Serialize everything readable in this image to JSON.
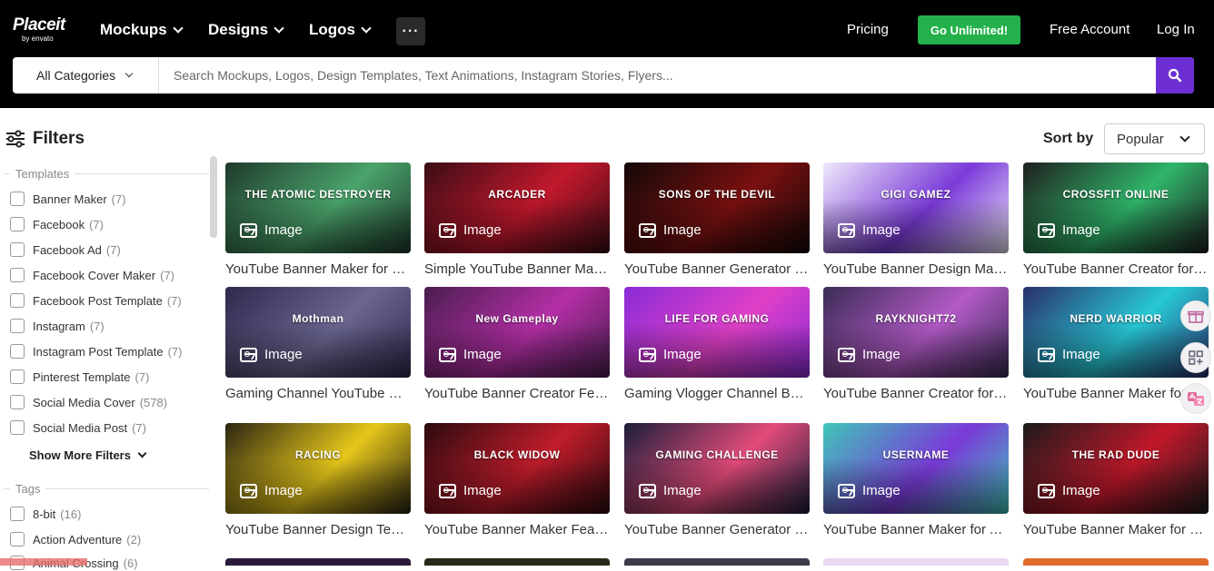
{
  "header": {
    "logo_word": "Placeit",
    "logo_by": "by envato",
    "nav": [
      "Mockups",
      "Designs",
      "Logos"
    ],
    "more_label": "···",
    "pricing": "Pricing",
    "go_unlimited": "Go Unlimited!",
    "free_account": "Free Account",
    "login": "Log In",
    "accent_color": "#24b14b",
    "search_button_color": "#6d2fd4"
  },
  "search": {
    "category": "All Categories",
    "placeholder": "Search Mockups, Logos, Design Templates, Text Animations, Instagram Stories, Flyers..."
  },
  "filters": {
    "title": "Filters",
    "templates_group": "Templates",
    "templates": [
      {
        "label": "Banner Maker",
        "count": "(7)"
      },
      {
        "label": "Facebook",
        "count": "(7)"
      },
      {
        "label": "Facebook Ad",
        "count": "(7)"
      },
      {
        "label": "Facebook Cover Maker",
        "count": "(7)"
      },
      {
        "label": "Facebook Post Template",
        "count": "(7)"
      },
      {
        "label": "Instagram",
        "count": "(7)"
      },
      {
        "label": "Instagram Post Template",
        "count": "(7)"
      },
      {
        "label": "Pinterest Template",
        "count": "(7)"
      },
      {
        "label": "Social Media Cover",
        "count": "(578)"
      },
      {
        "label": "Social Media Post",
        "count": "(7)"
      }
    ],
    "show_more": "Show More Filters",
    "tags_group": "Tags",
    "tags": [
      {
        "label": "8-bit",
        "count": "(16)"
      },
      {
        "label": "Action Adventure",
        "count": "(2)"
      },
      {
        "label": "Animal Crossing",
        "count": "(6)"
      }
    ]
  },
  "sort": {
    "label": "Sort by",
    "value": "Popular"
  },
  "badge_label": "Image",
  "cards": [
    {
      "title": "YouTube Banner Maker for a Gaming Channel",
      "headline": "THE ATOMIC DESTROYER",
      "bg": "#1f3a2c",
      "accent": "#4aa36b"
    },
    {
      "title": "Simple YouTube Banner Maker for Gaming",
      "headline": "ARCADER",
      "bg": "#3a0d14",
      "accent": "#c2182d"
    },
    {
      "title": "YouTube Banner Generator for Gamers",
      "headline": "SONS OF THE DEVIL",
      "bg": "#140808",
      "accent": "#7a1010"
    },
    {
      "title": "YouTube Banner Design Maker for Streamers",
      "headline": "GIGI GAMEZ",
      "bg": "#efe9fb",
      "accent": "#7a3ad8"
    },
    {
      "title": "YouTube Banner Creator for CrossFit",
      "headline": "CROSSFIT ONLINE",
      "bg": "#1f1f1f",
      "accent": "#2fb56a"
    },
    {
      "title": "Gaming Channel YouTube Banner Maker",
      "headline": "Mothman",
      "bg": "#2e2a4d",
      "accent": "#6a6690"
    },
    {
      "title": "YouTube Banner Creator Featuring a Gamer",
      "headline": "New Gameplay",
      "bg": "#4a1d4f",
      "accent": "#b42fa6"
    },
    {
      "title": "Gaming Vlogger Channel Banner Maker",
      "headline": "LIFE FOR GAMING",
      "bg": "#8a2bd6",
      "accent": "#e040c8"
    },
    {
      "title": "YouTube Banner Creator for Gaming Channels",
      "headline": "RAYKNIGHT72",
      "bg": "#3a2c55",
      "accent": "#b35ac7"
    },
    {
      "title": "YouTube Banner Maker for a Nerd Warrior",
      "headline": "NERD WARRIOR",
      "bg": "#2a2f6a",
      "accent": "#27c9d6"
    },
    {
      "title": "YouTube Banner Design Template for Racing",
      "headline": "RACING",
      "bg": "#2a2512",
      "accent": "#e6c61a"
    },
    {
      "title": "YouTube Banner Maker Featuring Black Widow",
      "headline": "BLACK WIDOW",
      "bg": "#2a0a0e",
      "accent": "#c01c2b"
    },
    {
      "title": "YouTube Banner Generator for Gaming Challenge",
      "headline": "GAMING CHALLENGE",
      "bg": "#1a1f3a",
      "accent": "#e34b7a"
    },
    {
      "title": "YouTube Banner Maker for A Channel Username",
      "headline": "USERNAME",
      "bg": "#3ec6b8",
      "accent": "#7a3ad8"
    },
    {
      "title": "YouTube Banner Maker for a Gameplay Review",
      "headline": "THE RAD DUDE",
      "bg": "#1a1a1a",
      "accent": "#c0182a"
    }
  ]
}
